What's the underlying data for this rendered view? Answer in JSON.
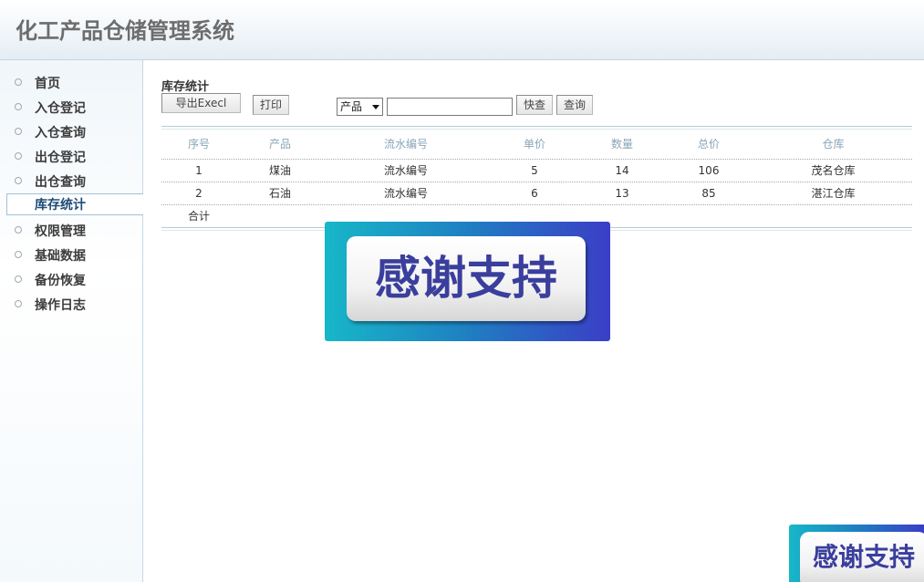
{
  "app": {
    "title": "化工产品仓储管理系统"
  },
  "sidebar": {
    "items": [
      {
        "label": "首页"
      },
      {
        "label": "入仓登记"
      },
      {
        "label": "入仓查询"
      },
      {
        "label": "出仓登记"
      },
      {
        "label": "出仓查询"
      },
      {
        "label": "库存统计",
        "active": true
      },
      {
        "label": "权限管理"
      },
      {
        "label": "基础数据"
      },
      {
        "label": "备份恢复"
      },
      {
        "label": "操作日志"
      }
    ]
  },
  "main": {
    "title": "库存统计",
    "toolbar": {
      "export_label": "导出Execl",
      "print_label": "打印",
      "filter_field": "产品",
      "search_value": "",
      "quick_search_label": "快查",
      "query_label": "查询"
    },
    "table": {
      "headers": [
        "序号",
        "产品",
        "流水编号",
        "单价",
        "数量",
        "总价",
        "仓库"
      ],
      "rows": [
        [
          "1",
          "煤油",
          "流水编号",
          "5",
          "14",
          "106",
          "茂名仓库"
        ],
        [
          "2",
          "石油",
          "流水编号",
          "6",
          "13",
          "85",
          "湛江仓库"
        ]
      ],
      "total_label": "合计"
    }
  },
  "banners": [
    {
      "text": "感谢支持"
    },
    {
      "text": "感谢支持"
    }
  ]
}
